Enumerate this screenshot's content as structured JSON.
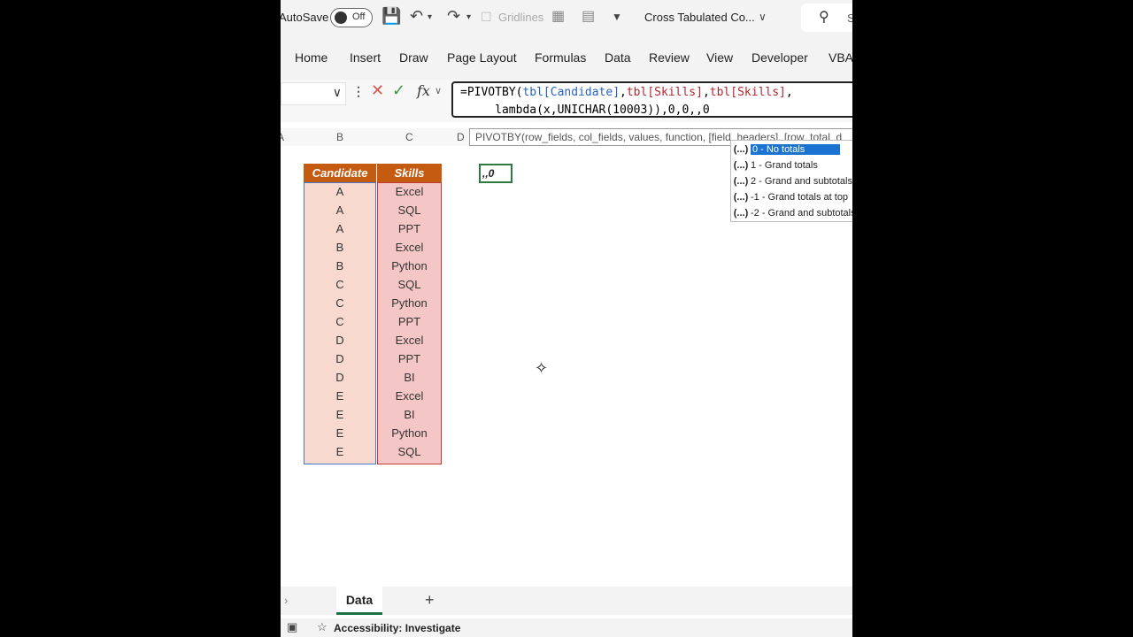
{
  "titlebar": {
    "autosave_label": "AutoSave",
    "autosave_state": "Off",
    "gridlines_label": "Gridlines",
    "file_title": "Cross Tabulated Co...",
    "search_hint": "S"
  },
  "ribbon": {
    "tabs": [
      "Home",
      "Insert",
      "Draw",
      "Page Layout",
      "Formulas",
      "Data",
      "Review",
      "View",
      "Developer",
      "VBA"
    ]
  },
  "formula_bar": {
    "fx_label": "fx",
    "line1_a": "=PIVOTBY(",
    "line1_ref1": "tbl[Candidate]",
    "line1_c1": ",",
    "line1_ref2": "tbl[Skills]",
    "line1_c2": ",",
    "line1_ref3": "tbl[Skills]",
    "line1_c3": ",",
    "line2": "     lambda(x,UNICHAR(10003)),0,0,,0"
  },
  "columns": [
    "A",
    "B",
    "C",
    "D"
  ],
  "tooltip": "PIVOTBY(row_fields, col_fields, values, function, [field_headers], [row_total_d",
  "autocomplete": {
    "icon": "(...)",
    "items": [
      "0 - No totals",
      "1 - Grand totals",
      "2 - Grand and subtotals",
      "-1 - Grand totals at top",
      "-2 - Grand and subtotals"
    ]
  },
  "table": {
    "headers": [
      "Candidate",
      "Skills"
    ],
    "rows": [
      [
        "A",
        "Excel"
      ],
      [
        "A",
        "SQL"
      ],
      [
        "A",
        "PPT"
      ],
      [
        "B",
        "Excel"
      ],
      [
        "B",
        "Python"
      ],
      [
        "C",
        "SQL"
      ],
      [
        "C",
        "Python"
      ],
      [
        "C",
        "PPT"
      ],
      [
        "D",
        "Excel"
      ],
      [
        "D",
        "PPT"
      ],
      [
        "D",
        "BI"
      ],
      [
        "E",
        "Excel"
      ],
      [
        "E",
        "BI"
      ],
      [
        "E",
        "Python"
      ],
      [
        "E",
        "SQL"
      ]
    ]
  },
  "editing_cell": ",,0",
  "sheets": {
    "active": "Data",
    "add_label": "+"
  },
  "status": {
    "accessibility": "Accessibility: Investigate"
  }
}
